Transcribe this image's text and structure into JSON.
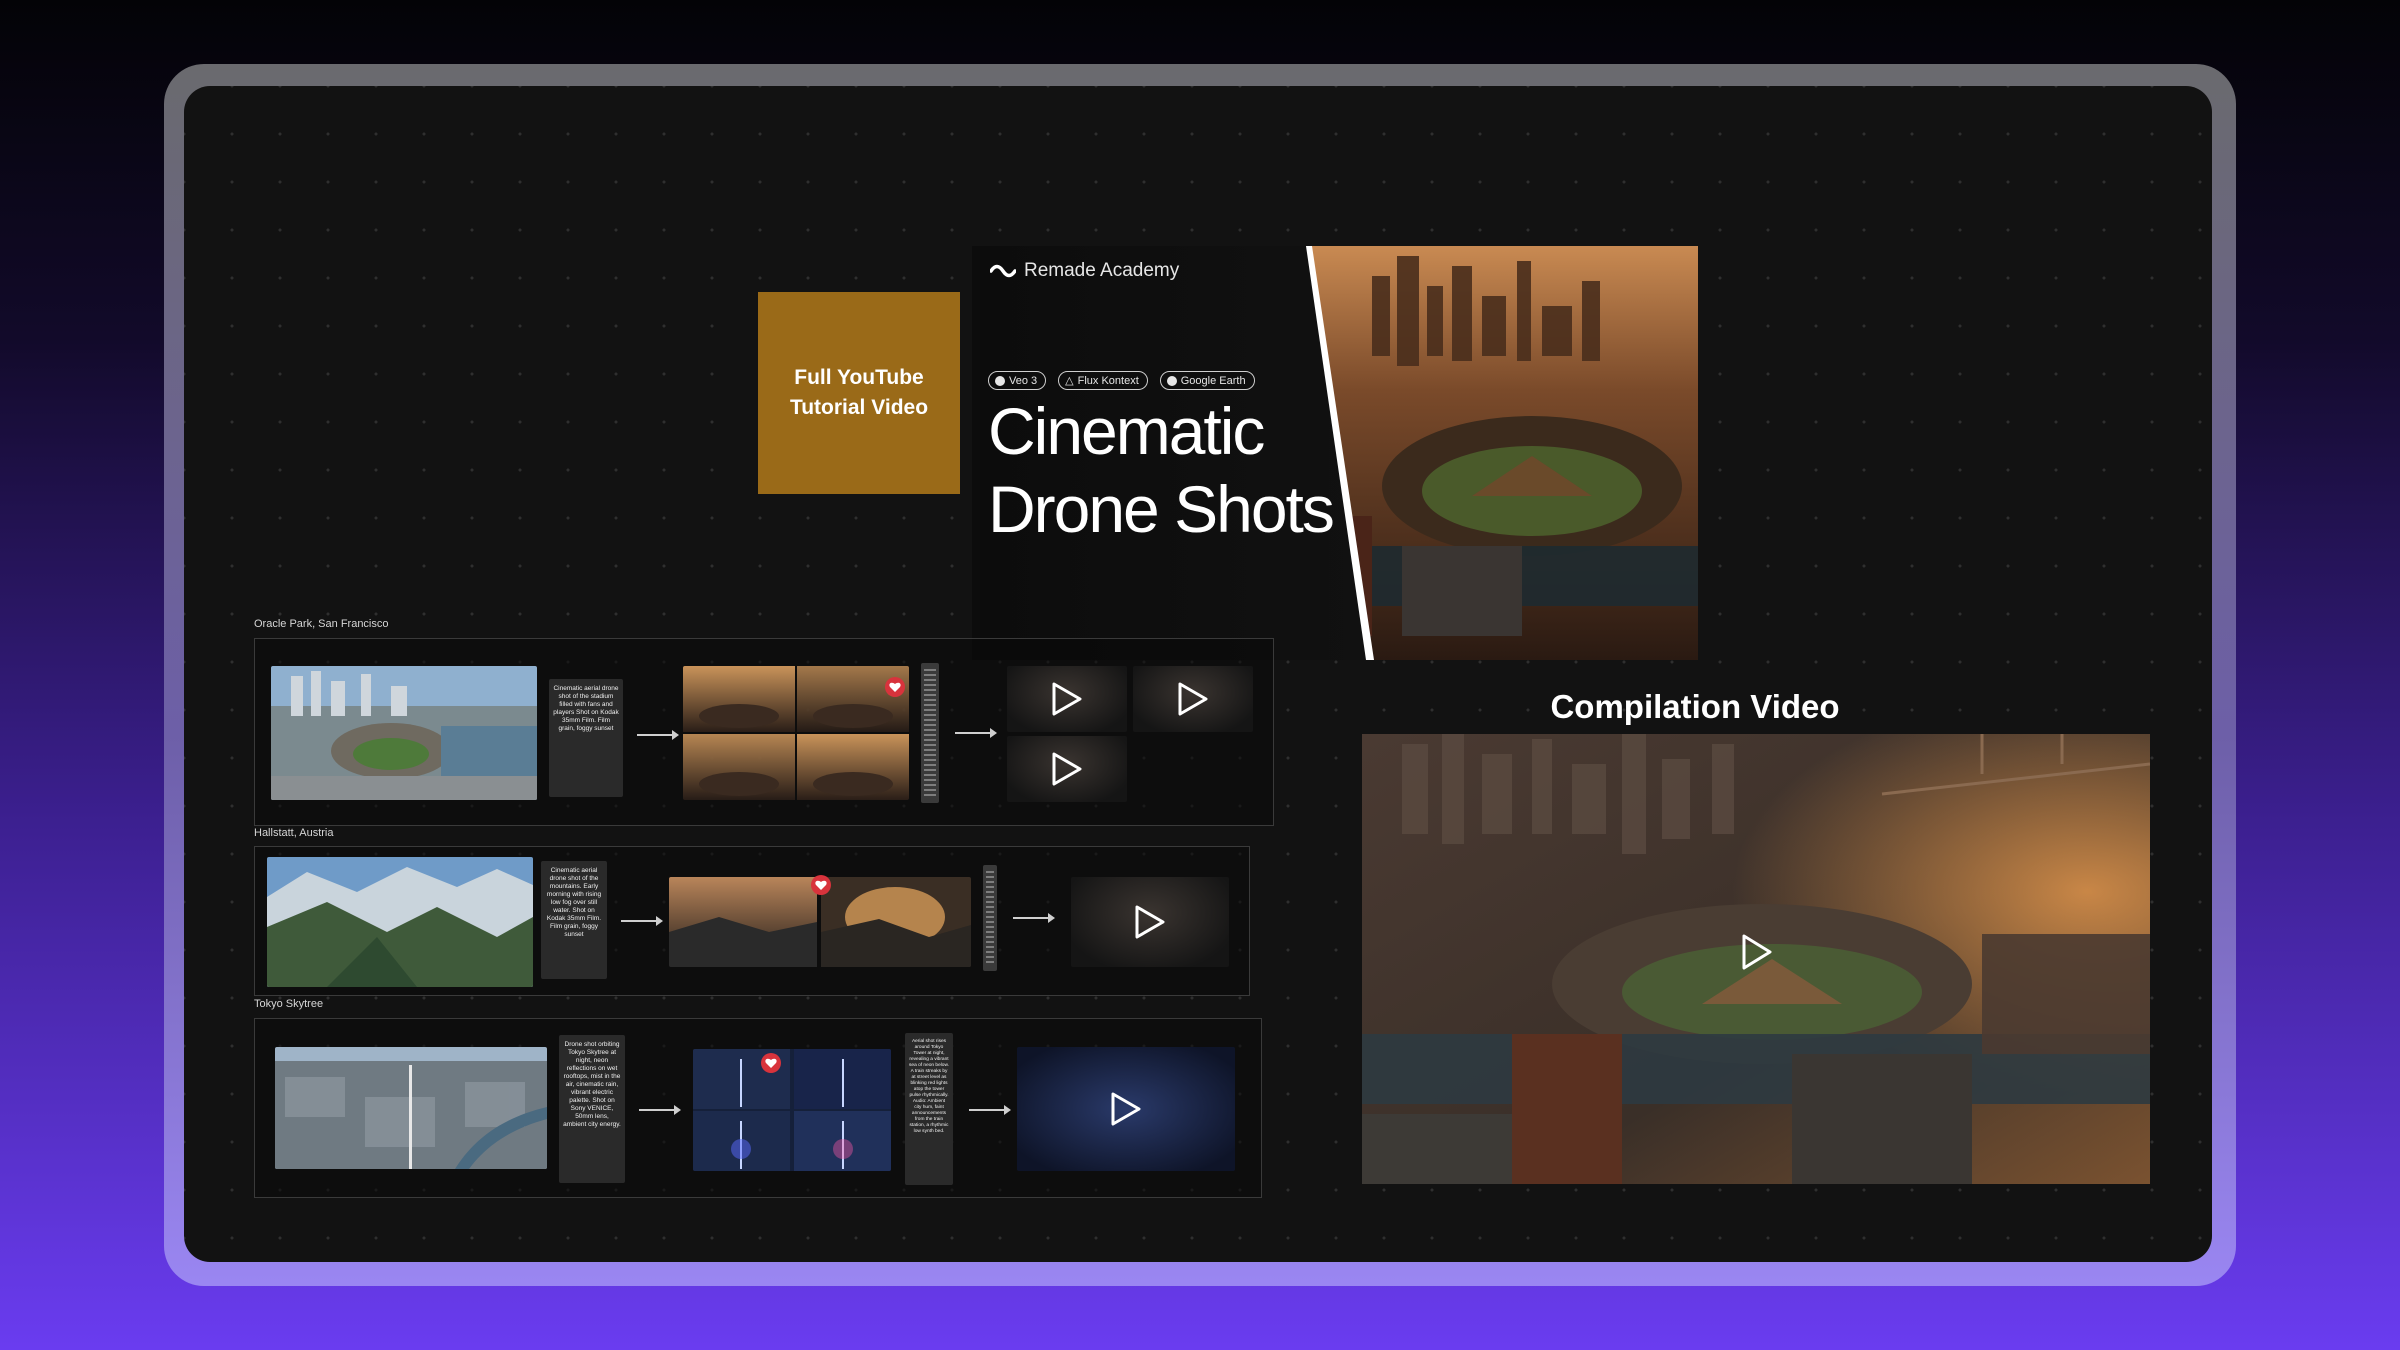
{
  "header": {
    "tutorial_box": "Full YouTube Tutorial Video",
    "brand": "Remade Academy",
    "tags": [
      "Veo 3",
      "Flux Kontext",
      "Google Earth"
    ],
    "title_line1": "Cinematic",
    "title_line2": "Drone Shots"
  },
  "workflows": [
    {
      "label": "Oracle Park, San Francisco",
      "prompt": "Cinematic aerial drone shot of the stadium filled with fans and players Shot on Kodak 35mm Film. Film grain, foggy sunset"
    },
    {
      "label": "Hallstatt, Austria",
      "prompt": "Cinematic aerial drone shot of the mountains. Early morning with rising low fog over still water. Shot on Kodak 35mm Film. Film grain, foggy sunset"
    },
    {
      "label": "Tokyo Skytree",
      "prompt": "Drone shot orbiting Tokyo Skytree at night, neon reflections on wet rooftops, mist in the air, cinematic rain, vibrant electric palette. Shot on Sony VENICE, 50mm lens, ambient city energy.",
      "prompt2": "Aerial shot rises around Tokyo Tower at night, revealing a vibrant sea of neon below. A train streaks by at street level as blinking red lights atop the tower pulse rhythmically. Audio: Ambient city hum, faint announcements from the train station, a rhythmic low synth bed."
    }
  ],
  "compilation": {
    "title": "Compilation Video"
  },
  "colors": {
    "tutorial_box": "#9a6a18",
    "canvas_bg": "#121212",
    "heart": "#d8333c"
  },
  "icons": [
    "play-icon",
    "heart-icon",
    "remade-logo-icon"
  ]
}
